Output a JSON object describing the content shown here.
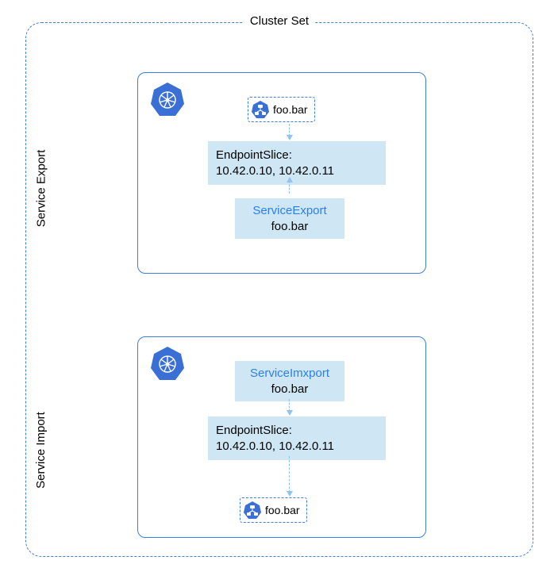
{
  "title": "Cluster Set",
  "sections": {
    "export": {
      "label": "Service Export"
    },
    "import": {
      "label": "Service Import"
    }
  },
  "service_name": "foo.bar",
  "endpointslice": {
    "label": "EndpointSlice:",
    "ips": "10.42.0.10, 10.42.0.11"
  },
  "export_cr": {
    "kind": "ServiceExport",
    "name": "foo.bar"
  },
  "import_cr": {
    "kind": "ServiceImxport",
    "name": "foo.bar"
  }
}
